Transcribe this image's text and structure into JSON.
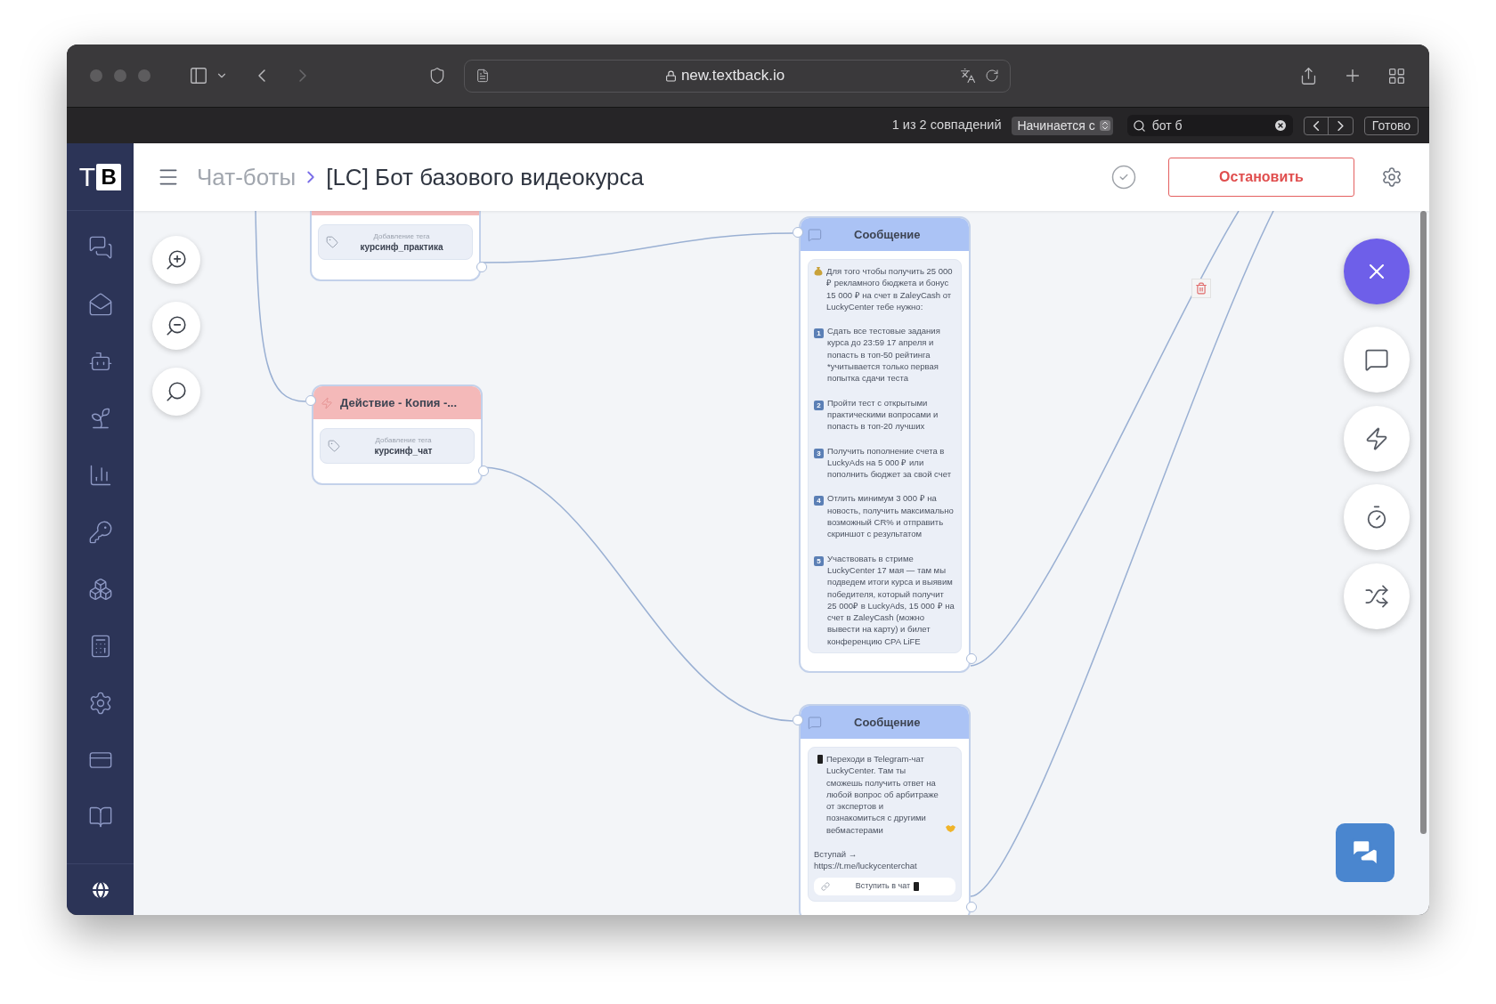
{
  "browser": {
    "url": "new.textback.io"
  },
  "find_bar": {
    "result": "1 из 2 совпадений",
    "mode": "Начинается с",
    "query": "бот б",
    "done_button": "Готово"
  },
  "sidebar": {
    "logo": {
      "letter": "T",
      "badge": "B"
    }
  },
  "header": {
    "breadcrumb": "Чат-боты",
    "title": "[LC] Бот базового видеокурса",
    "stop_button": "Остановить"
  },
  "nodes": [
    {
      "kind": "action",
      "items": [
        {
          "label": "Добавление тега",
          "value": "курсинф_практика"
        }
      ]
    },
    {
      "kind": "action",
      "title": "Действие - Копия -...",
      "items": [
        {
          "label": "Добавление тега",
          "value": "курсинф_чат"
        }
      ]
    },
    {
      "kind": "message",
      "title": "Сообщение",
      "paragraphs": [
        {
          "kind": "money",
          "text": "Для того чтобы получить 25 000 ₽ рекламного бюджета и бонус 15 000 ₽ на счет в ZaleyCash от LuckyCenter тебе нужно:"
        },
        {
          "kind": "number",
          "number": "1",
          "text": "Сдать все тестовые задания курса до 23:59 17 апреля и попасть в топ-50 рейтинга *учитывается только первая попытка сдачи теста"
        },
        {
          "kind": "number",
          "number": "2",
          "text": "Пройти тест с открытыми практическими вопросами и попасть в топ-20 лучших"
        },
        {
          "kind": "number",
          "number": "3",
          "text": "Получить пополнение счета в LuckyAds на 5 000 ₽ или пополнить бюджет за свой счет"
        },
        {
          "kind": "number",
          "number": "4",
          "text": "Отлить минимум 3 000 ₽ на новость, получить максимально возможный CR% и отправить скриншот с результатом"
        },
        {
          "kind": "number",
          "number": "5",
          "text": "Участвовать в стриме LuckyCenter 17 мая — там мы подведем итоги курса и выявим победителя, который получит 25 000₽ в LuckyAds, 15 000 ₽ на счет в ZaleyCash (можно вывести на карту) и билет конференцию CPA LiFE"
        }
      ]
    },
    {
      "kind": "message",
      "title": "Сообщение",
      "paragraphs": [
        {
          "kind": "phone",
          "text": "Переходи в Telegram-чат LuckyCenter. Там ты сможешь получить ответ на любой вопрос об арбитраже от экспертов и познакомиться с другими вебмастерами",
          "handshake_icon": true
        },
        {
          "kind": "plain",
          "text": "Вступай → https://t.me/luckycenterchat"
        }
      ],
      "buttons": [
        {
          "label": "Вступить в чат",
          "phone_icon": true
        }
      ]
    }
  ]
}
